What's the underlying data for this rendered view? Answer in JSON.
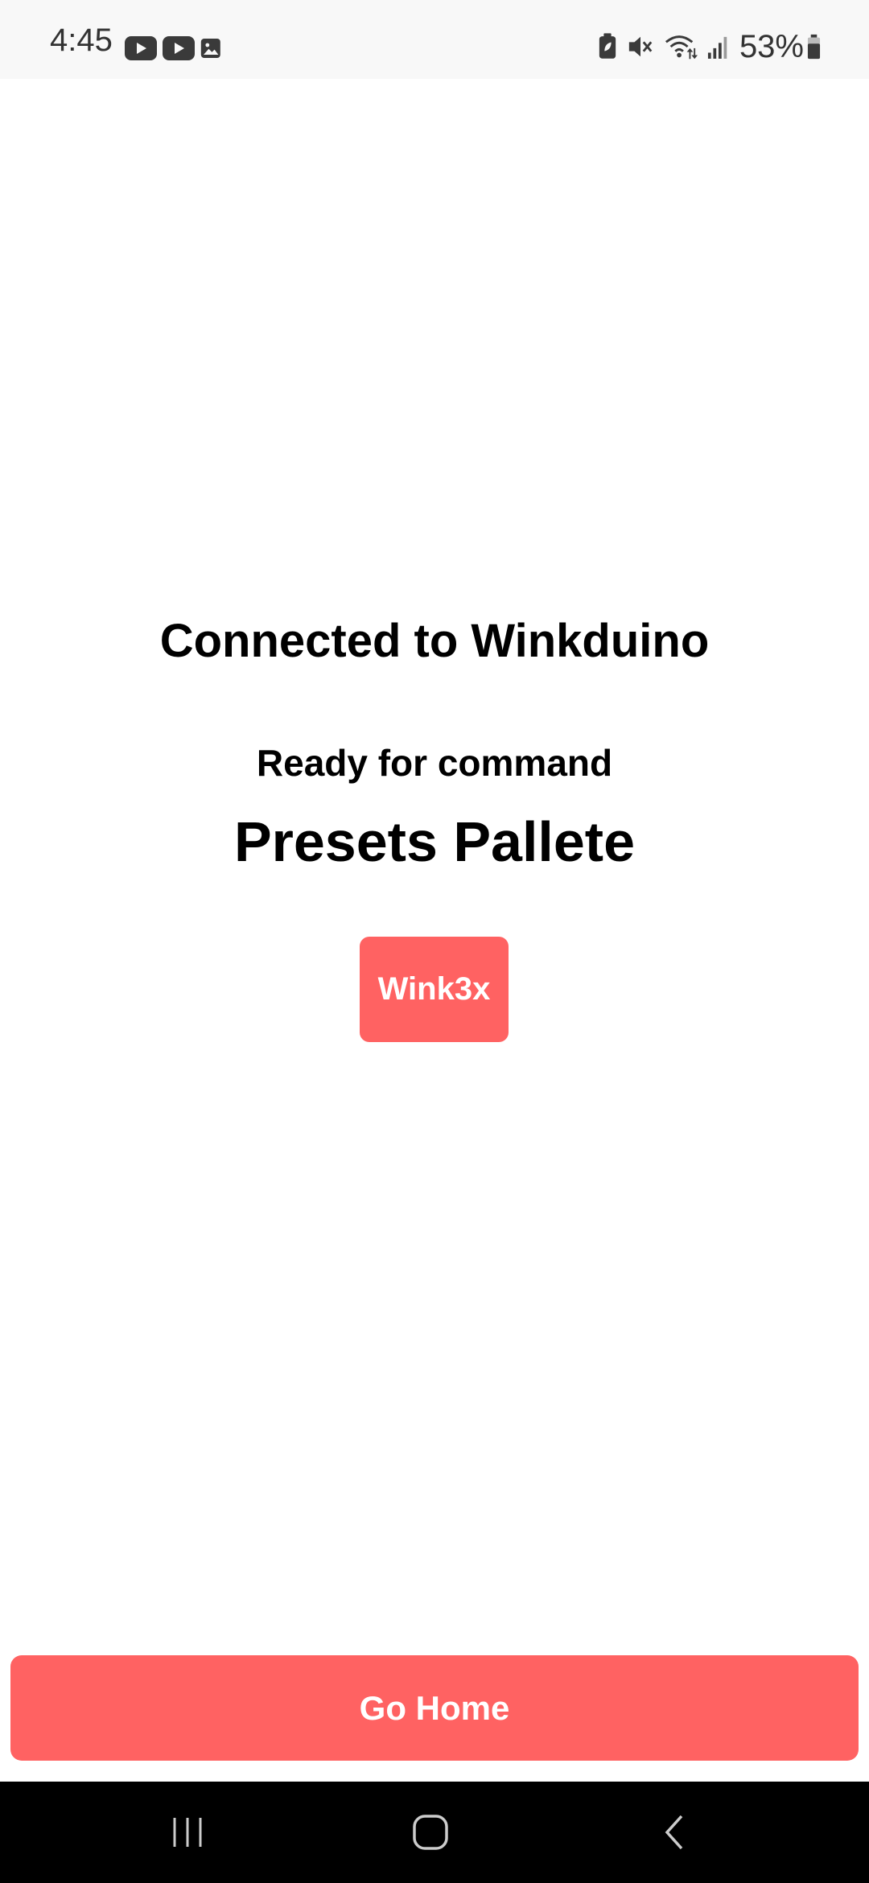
{
  "status_bar": {
    "time": "4:45",
    "left_icons": [
      "youtube-icon",
      "youtube-icon",
      "image-icon"
    ],
    "right_icons": [
      "battery-saver-icon",
      "mute-icon",
      "wifi-icon",
      "signal-icon"
    ],
    "battery_percent": "53%"
  },
  "main": {
    "connection_title": "Connected to Winkduino",
    "status_text": "Ready for command",
    "section_title": "Presets Pallete",
    "presets": [
      {
        "label": "Wink3x"
      }
    ],
    "go_home_label": "Go Home"
  },
  "colors": {
    "accent": "#ff6262",
    "text": "#000000",
    "background": "#ffffff",
    "nav_bar": "#000000"
  }
}
